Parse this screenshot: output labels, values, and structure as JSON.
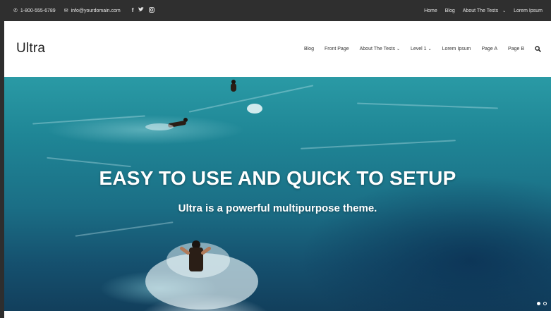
{
  "topbar": {
    "phone": "1-800-555-6789",
    "email": "info@yourdomain.com",
    "social_icons": [
      "facebook-icon",
      "twitter-icon",
      "instagram-icon"
    ],
    "links": [
      {
        "label": "Home",
        "has_dropdown": false
      },
      {
        "label": "Blog",
        "has_dropdown": false
      },
      {
        "label": "About The Tests",
        "has_dropdown": true
      },
      {
        "label": "Lorem Ipsum",
        "has_dropdown": false
      }
    ]
  },
  "header": {
    "logo": "Ultra",
    "nav": [
      {
        "label": "Blog",
        "has_dropdown": false
      },
      {
        "label": "Front Page",
        "has_dropdown": false
      },
      {
        "label": "About The Tests",
        "has_dropdown": true
      },
      {
        "label": "Level 1",
        "has_dropdown": true
      },
      {
        "label": "Lorem Ipsum",
        "has_dropdown": false
      },
      {
        "label": "Page A",
        "has_dropdown": false
      },
      {
        "label": "Page B",
        "has_dropdown": false
      }
    ],
    "search_icon": "search-icon"
  },
  "hero": {
    "title": "EASY TO USE AND QUICK TO SETUP",
    "subtitle": "Ultra is a powerful multipurpose theme.",
    "slides_total": 2,
    "active_slide": 1
  },
  "colors": {
    "topbar_bg": "#2f2f2f",
    "header_bg": "#ffffff",
    "hero_text": "#ffffff",
    "ocean": "#1b6f86"
  }
}
